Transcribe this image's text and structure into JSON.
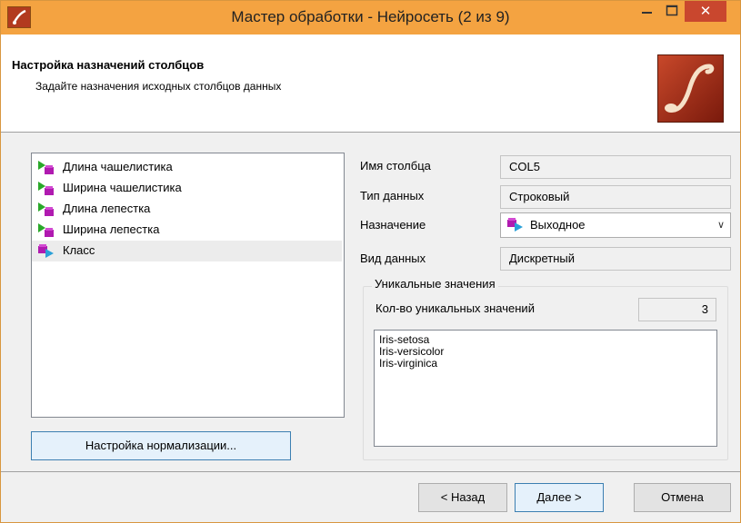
{
  "window": {
    "title": "Мастер обработки - Нейросеть (2 из 9)",
    "accent_color": "#f4a341",
    "close_icon": "close-icon",
    "min_icon": "minimize-icon",
    "max_icon": "maximize-icon"
  },
  "header": {
    "title": "Настройка назначений столбцов",
    "subtitle": "Задайте назначения исходных столбцов данных"
  },
  "columns": [
    {
      "label": "Длина чашелистика",
      "icon": "input-column-icon"
    },
    {
      "label": "Ширина чашелистика",
      "icon": "input-column-icon"
    },
    {
      "label": "Длина лепестка",
      "icon": "input-column-icon"
    },
    {
      "label": "Ширина лепестка",
      "icon": "input-column-icon"
    },
    {
      "label": "Класс",
      "icon": "output-column-icon",
      "selected": true
    }
  ],
  "normalize_button": "Настройка нормализации...",
  "props": {
    "name_label": "Имя столбца",
    "name_value": "COL5",
    "type_label": "Тип данных",
    "type_value": "Строковый",
    "purpose_label": "Назначение",
    "purpose_value": "Выходное",
    "kind_label": "Вид данных",
    "kind_value": "Дискретный"
  },
  "unique": {
    "group_title": "Уникальные значения",
    "count_label": "Кол-во уникальных значений",
    "count_value": "3",
    "values": [
      "Iris-setosa",
      "Iris-versicolor",
      "Iris-virginica"
    ]
  },
  "buttons": {
    "back": "< Назад",
    "next": "Далее >",
    "cancel": "Отмена"
  }
}
